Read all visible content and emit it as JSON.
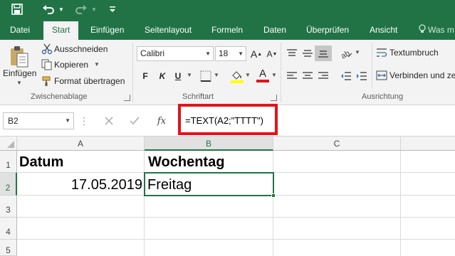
{
  "quick_access": {
    "save_icon": "save-icon",
    "undo_icon": "undo-icon",
    "redo_icon": "redo-icon",
    "customize_icon": "customize-qat-icon"
  },
  "tabs": [
    {
      "label": "Datei"
    },
    {
      "label": "Start"
    },
    {
      "label": "Einfügen"
    },
    {
      "label": "Seitenlayout"
    },
    {
      "label": "Formeln"
    },
    {
      "label": "Daten"
    },
    {
      "label": "Überprüfen"
    },
    {
      "label": "Ansicht"
    },
    {
      "label": "Was m"
    }
  ],
  "ribbon": {
    "clipboard": {
      "paste_label": "Einfügen",
      "cut_label": "Ausschneiden",
      "copy_label": "Kopieren",
      "format_painter_label": "Format übertragen",
      "group_label": "Zwischenablage"
    },
    "font": {
      "font_name": "Calibri",
      "font_size": "18",
      "bold": "F",
      "italic": "K",
      "underline": "U",
      "font_color_letter": "A",
      "group_label": "Schriftart",
      "highlight_color": "#ffff00",
      "font_color": "#e0141e"
    },
    "alignment": {
      "wrap_text_label": "Textumbruch",
      "merge_label": "Verbinden und ze",
      "group_label": "Ausrichtung"
    }
  },
  "formula_bar": {
    "name_box": "B2",
    "cancel_icon": "cancel-icon",
    "enter_icon": "check-icon",
    "fx_label": "fx",
    "formula": "=TEXT(A2;\"TTTT\")"
  },
  "sheet": {
    "columns": [
      "A",
      "B",
      "C"
    ],
    "rows": [
      "1",
      "2",
      "3",
      "4",
      "5"
    ],
    "cells": {
      "A1": "Datum",
      "B1": "Wochentag",
      "A2": "17.05.2019",
      "B2": "Freitag"
    },
    "selected_cell": "B2"
  },
  "colors": {
    "accent": "#217346",
    "highlight_border": "#e0141e"
  }
}
